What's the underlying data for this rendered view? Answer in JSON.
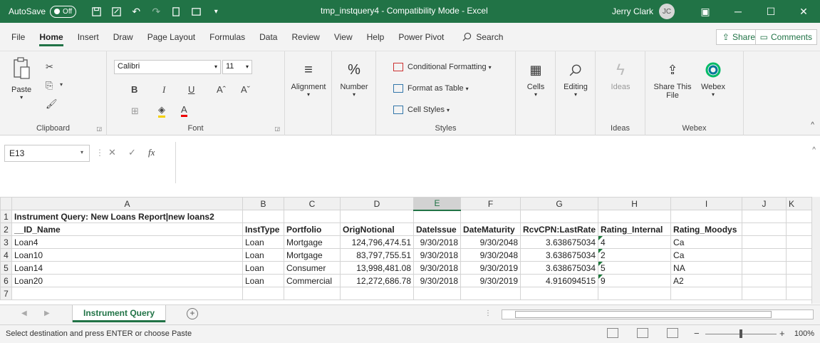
{
  "titlebar": {
    "autosave_label": "AutoSave",
    "autosave_state": "Off",
    "file_title": "tmp_instquery4  -  Compatibility Mode  -  Excel",
    "user_name": "Jerry Clark",
    "user_initials": "JC"
  },
  "menu": {
    "tabs": [
      "File",
      "Home",
      "Insert",
      "Draw",
      "Page Layout",
      "Formulas",
      "Data",
      "Review",
      "View",
      "Help",
      "Power Pivot"
    ],
    "active": "Home",
    "search_label": "Search",
    "share_label": "Share",
    "comments_label": "Comments"
  },
  "ribbon": {
    "clipboard": {
      "paste": "Paste",
      "label": "Clipboard"
    },
    "font": {
      "name": "Calibri",
      "size": "11",
      "bold": "B",
      "italic": "I",
      "underline": "U",
      "label": "Font"
    },
    "alignment": {
      "label": "Alignment"
    },
    "number": {
      "label": "Number",
      "symbol": "%"
    },
    "styles": {
      "conditional": "Conditional Formatting",
      "format_table": "Format as Table",
      "cell_styles": "Cell Styles",
      "label": "Styles"
    },
    "cells": {
      "label": "Cells"
    },
    "editing": {
      "label": "Editing"
    },
    "ideas": {
      "button": "Ideas",
      "label": "Ideas"
    },
    "webex": {
      "share_line1": "Share This",
      "share_line2": "File",
      "webex": "Webex",
      "label": "Webex"
    }
  },
  "formula_bar": {
    "cell_ref": "E13",
    "fx": "fx",
    "value": ""
  },
  "grid": {
    "columns": [
      "A",
      "B",
      "C",
      "D",
      "E",
      "F",
      "G",
      "H",
      "I",
      "J",
      "K"
    ],
    "selected_column": "E",
    "rows": [
      {
        "n": "1",
        "cells": [
          "Instrument Query: New Loans Report|new loans2",
          "",
          "",
          "",
          "",
          "",
          "",
          "",
          "",
          "",
          ""
        ]
      },
      {
        "n": "2",
        "cells": [
          "__ID_Name",
          "InstType",
          "Portfolio",
          "OrigNotional",
          "DateIssue",
          "DateMaturity",
          "RcvCPN:LastRate",
          "Rating_Internal",
          "Rating_Moodys",
          "",
          ""
        ]
      },
      {
        "n": "3",
        "cells": [
          "Loan4",
          "Loan",
          "Mortgage",
          "124,796,474.51",
          "9/30/2018",
          "9/30/2048",
          "3.638675034",
          "4",
          "Ca",
          "",
          ""
        ]
      },
      {
        "n": "4",
        "cells": [
          "Loan10",
          "Loan",
          "Mortgage",
          "83,797,755.51",
          "9/30/2018",
          "9/30/2048",
          "3.638675034",
          "2",
          "Ca",
          "",
          ""
        ]
      },
      {
        "n": "5",
        "cells": [
          "Loan14",
          "Loan",
          "Consumer",
          "13,998,481.08",
          "9/30/2018",
          "9/30/2019",
          "3.638675034",
          "5",
          "NA",
          "",
          ""
        ]
      },
      {
        "n": "6",
        "cells": [
          "Loan20",
          "Loan",
          "Commercial",
          "12,272,686.78",
          "9/30/2018",
          "9/30/2019",
          "4.916094515",
          "9",
          "A2",
          "",
          ""
        ]
      },
      {
        "n": "7",
        "cells": [
          "",
          "",
          "",
          "",
          "",
          "",
          "",
          "",
          "",
          "",
          ""
        ]
      }
    ]
  },
  "sheets": {
    "tabs": [
      "Instrument Query"
    ],
    "active": "Instrument Query"
  },
  "status": {
    "message": "Select destination and press ENTER or choose Paste",
    "zoom": "100%"
  }
}
